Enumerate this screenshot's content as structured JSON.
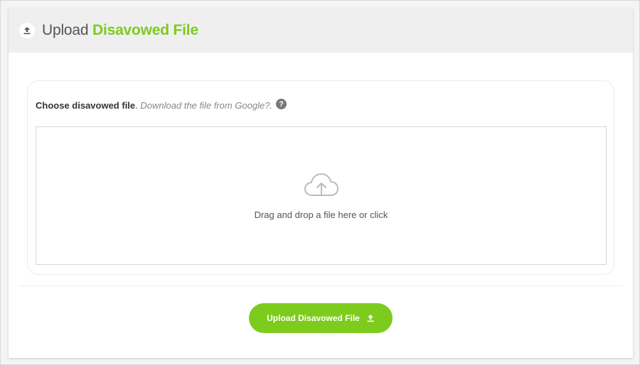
{
  "header": {
    "title_prefix": "Upload",
    "title_accent": "Disavowed File",
    "icon": "upload-icon"
  },
  "form": {
    "label": "Choose disavowed file",
    "separator": ".",
    "hint": "Download the file from Google?.",
    "help_icon_glyph": "?",
    "help_icon": "help-icon"
  },
  "dropzone": {
    "icon": "cloud-upload-icon",
    "text": "Drag and drop a file here or click"
  },
  "actions": {
    "upload_label": "Upload Disavowed File",
    "upload_icon": "upload-icon"
  },
  "colors": {
    "accent": "#7dcb1d",
    "header_bg": "#efefef",
    "text": "#555555"
  }
}
